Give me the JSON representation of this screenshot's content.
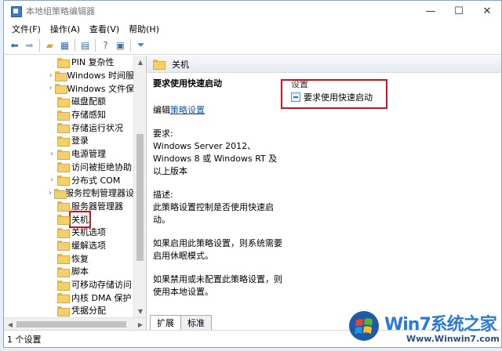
{
  "window": {
    "title": "本地组策略编辑器",
    "minimize": "—",
    "maximize": "☐",
    "close": "✕"
  },
  "menu": [
    "文件(F)",
    "操作(A)",
    "查看(V)",
    "帮助(H)"
  ],
  "tree": [
    {
      "label": "PIN 复杂性",
      "expandable": false
    },
    {
      "label": "Windows 时间服",
      "expandable": true
    },
    {
      "label": "Windows 文件保",
      "expandable": true
    },
    {
      "label": "磁盘配额",
      "expandable": false
    },
    {
      "label": "存储感知",
      "expandable": false
    },
    {
      "label": "存储运行状况",
      "expandable": false
    },
    {
      "label": "登录",
      "expandable": false
    },
    {
      "label": "电源管理",
      "expandable": true
    },
    {
      "label": "访问被拒绝协助",
      "expandable": false
    },
    {
      "label": "分布式 COM",
      "expandable": true
    },
    {
      "label": "服务控制管理器设",
      "expandable": true
    },
    {
      "label": "服务器管理器",
      "expandable": false
    },
    {
      "label": "关机",
      "expandable": false,
      "selected": true
    },
    {
      "label": "关机选项",
      "expandable": false
    },
    {
      "label": "缓解选项",
      "expandable": false
    },
    {
      "label": "恢复",
      "expandable": false
    },
    {
      "label": "脚本",
      "expandable": false
    },
    {
      "label": "可移动存储访问",
      "expandable": false
    },
    {
      "label": "内核 DMA 保护",
      "expandable": false
    },
    {
      "label": "凭据分配",
      "expandable": false
    }
  ],
  "right_header": "关机",
  "description": {
    "title": "要求使用快速启动",
    "edit_prefix": "编辑",
    "edit_link": "策略设置",
    "requirements_label": "要求:",
    "requirements_text": "Windows Server 2012、Windows 8 或 Windows RT 及以上版本",
    "desc_label": "描述:",
    "desc_text": "此策略设置控制是否使用快速启动。",
    "enabled_text": "如果启用此策略设置，则系统需要启用休眠模式。",
    "disabled_text": "如果禁用或未配置此策略设置，则使用本地设置。"
  },
  "settings": {
    "column": "设置",
    "rows": [
      "要求使用快速启动"
    ]
  },
  "tabs": [
    "扩展",
    "标准"
  ],
  "status": "1 个设置",
  "watermark": {
    "brand": "Win7系统之家",
    "url": "Www.Winwin7.com"
  }
}
